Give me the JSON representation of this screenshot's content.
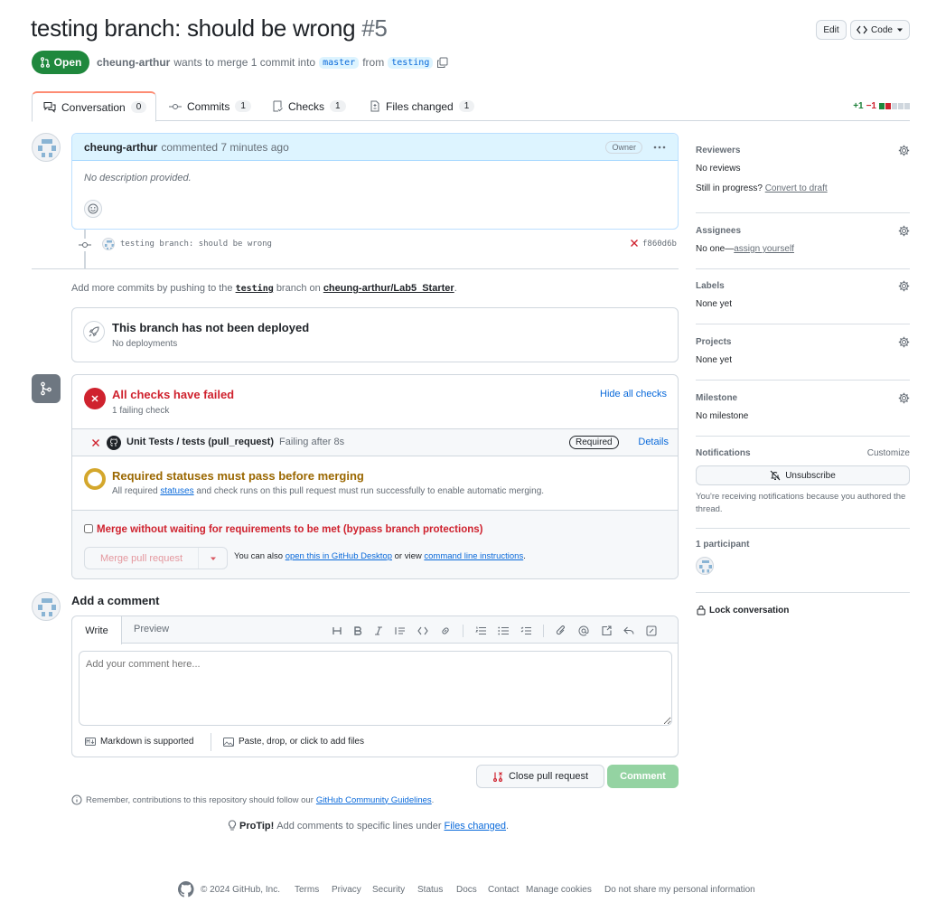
{
  "pr": {
    "title": "testing branch: should be wrong",
    "number": "#5",
    "status": "Open",
    "author": "cheung-arthur",
    "merge_text": "wants to merge 1 commit into",
    "base": "master",
    "from_text": "from",
    "head": "testing"
  },
  "header_buttons": {
    "edit": "Edit",
    "code": "Code"
  },
  "tabs": [
    {
      "label": "Conversation",
      "count": "0"
    },
    {
      "label": "Commits",
      "count": "1"
    },
    {
      "label": "Checks",
      "count": "1"
    },
    {
      "label": "Files changed",
      "count": "1"
    }
  ],
  "diffstat": {
    "add": "+1",
    "del": "−1"
  },
  "comment": {
    "author": "cheung-arthur",
    "action": "commented 7 minutes ago",
    "badge": "Owner",
    "body": "No description provided."
  },
  "commit": {
    "message": "testing branch: should be wrong",
    "sha": "f860d6b"
  },
  "push_hint": {
    "prefix": "Add more commits by pushing to the",
    "branch": "testing",
    "middle": "branch on",
    "repo": "cheung-arthur/Lab5_Starter",
    "suffix": "."
  },
  "deploy": {
    "title": "This branch has not been deployed",
    "subtitle": "No deployments"
  },
  "checks": {
    "title": "All checks have failed",
    "subtitle": "1 failing check",
    "hide": "Hide all checks",
    "item": {
      "name": "Unit Tests / tests (pull_request)",
      "status": "Failing after 8s",
      "required": "Required",
      "details": "Details"
    },
    "req_title": "Required statuses must pass before merging",
    "req_text_a": "All required",
    "req_link": "statuses",
    "req_text_b": "and check runs on this pull request must run successfully to enable automatic merging.",
    "bypass": "Merge without waiting for requirements to be met (bypass branch protections)",
    "merge_button": "Merge pull request",
    "also_a": "You can also",
    "also_link1": "open this in GitHub Desktop",
    "also_b": "or view",
    "also_link2": "command line instructions",
    "also_c": "."
  },
  "add_comment": {
    "heading": "Add a comment",
    "tab_write": "Write",
    "tab_preview": "Preview",
    "placeholder": "Add your comment here...",
    "markdown": "Markdown is supported",
    "attach": "Paste, drop, or click to add files",
    "close_button": "Close pull request",
    "comment_button": "Comment",
    "remember_a": "Remember, contributions to this repository should follow our",
    "remember_link": "GitHub Community Guidelines",
    "remember_b": ".",
    "protip_label": "ProTip!",
    "protip_a": "Add comments to specific lines under",
    "protip_link": "Files changed",
    "protip_b": "."
  },
  "sidebar": {
    "reviewers": {
      "title": "Reviewers",
      "value": "No reviews",
      "progress": "Still in progress?",
      "draft_link": "Convert to draft"
    },
    "assignees": {
      "title": "Assignees",
      "value": "No one—",
      "assign_link": "assign yourself"
    },
    "labels": {
      "title": "Labels",
      "value": "None yet"
    },
    "projects": {
      "title": "Projects",
      "value": "None yet"
    },
    "milestone": {
      "title": "Milestone",
      "value": "No milestone"
    },
    "notifications": {
      "title": "Notifications",
      "customize": "Customize",
      "unsubscribe": "Unsubscribe",
      "note": "You're receiving notifications because you authored the thread."
    },
    "participants": {
      "title": "1 participant"
    },
    "lock": "Lock conversation"
  },
  "footer": {
    "copyright": "© 2024 GitHub, Inc.",
    "links": [
      "Terms",
      "Privacy",
      "Security",
      "Status",
      "Docs",
      "Contact",
      "Manage cookies",
      "Do not share my personal information"
    ]
  },
  "colors": {
    "accent": "#0969da",
    "open_green": "#1f883d",
    "fail_red": "#cf222e",
    "warn": "#9a6700"
  }
}
